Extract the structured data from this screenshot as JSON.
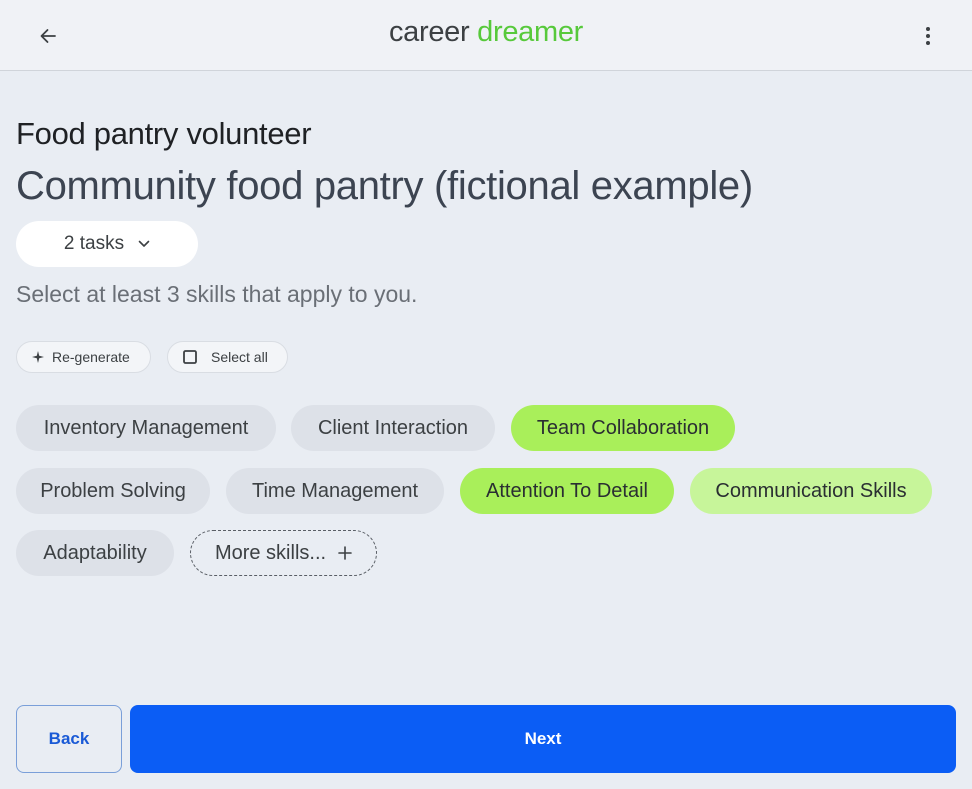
{
  "header": {
    "logo_part1": "career ",
    "logo_part2": "dreamer",
    "back_icon": "arrow-left-icon",
    "menu_icon": "more-vert-icon"
  },
  "role": {
    "title": "Food pantry volunteer",
    "organization": "Community food pantry (fictional example)"
  },
  "tasks_dropdown": {
    "label": "2 tasks",
    "icon": "chevron-down-icon"
  },
  "instruction": "Select at least 3 skills that apply to you.",
  "actions": {
    "regenerate_label": "Re-generate",
    "select_all_label": "Select all"
  },
  "skills": [
    {
      "label": "Inventory Management",
      "selected": false
    },
    {
      "label": "Client Interaction",
      "selected": false
    },
    {
      "label": "Team Collaboration",
      "selected": true
    },
    {
      "label": "Problem Solving",
      "selected": false
    },
    {
      "label": "Time Management",
      "selected": false
    },
    {
      "label": "Attention To Detail",
      "selected": true
    },
    {
      "label": "Communication Skills",
      "selected": true
    },
    {
      "label": "Adaptability",
      "selected": false
    }
  ],
  "more_skills_label": "More skills...",
  "footer": {
    "back_label": "Back",
    "next_label": "Next"
  },
  "colors": {
    "accent_blue": "#0b5df5",
    "selected_green": "#a9ef5a",
    "logo_green": "#57c93b"
  }
}
